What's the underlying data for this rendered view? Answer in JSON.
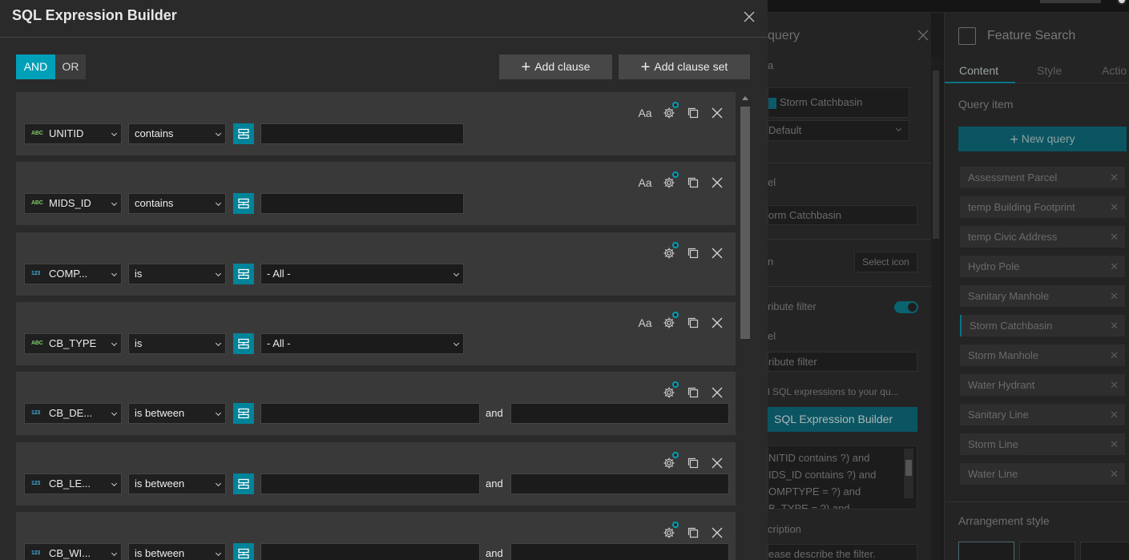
{
  "modal": {
    "title": "SQL Expression Builder",
    "logic": {
      "and": "AND",
      "or": "OR",
      "selected": "AND"
    },
    "add_clause": "Add clause",
    "add_clause_set": "Add clause set",
    "and_word": "and",
    "aa": "Aa",
    "clauses": [
      {
        "type_icon": "ABC",
        "field": "UNITID",
        "operator": "contains",
        "value_kind": "text",
        "case_toggle": true
      },
      {
        "type_icon": "ABC",
        "field": "MIDS_ID",
        "operator": "contains",
        "value_kind": "text",
        "case_toggle": true
      },
      {
        "type_icon": "123",
        "field": "COMP...",
        "operator": "is",
        "value_kind": "select",
        "value": "- All -",
        "case_toggle": false
      },
      {
        "type_icon": "ABC",
        "field": "CB_TYPE",
        "operator": "is",
        "value_kind": "select",
        "value": "- All -",
        "case_toggle": true
      },
      {
        "type_icon": "123",
        "field": "CB_DE...",
        "operator": "is between",
        "value_kind": "range",
        "case_toggle": false
      },
      {
        "type_icon": "123",
        "field": "CB_LE...",
        "operator": "is between",
        "value_kind": "range",
        "case_toggle": false
      },
      {
        "type_icon": "123",
        "field": "CB_WI...",
        "operator": "is between",
        "value_kind": "range",
        "case_toggle": false
      }
    ]
  },
  "query_panel": {
    "title": "query",
    "label_a": "a",
    "layer_name": "Storm Catchbasin",
    "layer_view": "Default",
    "label_label": "el",
    "label_value": "orm Catchbasin",
    "icon_label": "n",
    "select_icon": "Select icon",
    "attr_filter": "ribute filter",
    "label2": "el",
    "label2_value": "ribute filter",
    "sql_hint": "l SQL expressions to your qu...",
    "sql_builder": "SQL Expression Builder",
    "expression_text": "NITID contains ?) and\nIDS_ID contains ?) and\nOMPTYPE = ?) and\nB_TYPE = ?) and",
    "description_label": "cription",
    "description_placeholder": "ease describe the filter."
  },
  "feature_search": {
    "title": "Feature Search",
    "tabs": [
      "Content",
      "Style",
      "Actio"
    ],
    "query_item": "Query item",
    "new_query": "New query",
    "items": [
      "Assessment Parcel",
      "temp Building Footprint",
      "temp Civic Address",
      "Hydro Pole",
      "Sanitary Manhole",
      "Storm Catchbasin",
      "Storm Manhole",
      "Water Hydrant",
      "Sanitary Line",
      "Storm Line",
      "Water Line"
    ],
    "selected_item": "Storm Catchbasin",
    "arrangement_style": "Arrangement style"
  },
  "colors": {
    "accent": "#00a0b8",
    "source_button": "#00849a",
    "text_type": "#7fc96a",
    "number_type": "#3fa9d8"
  }
}
